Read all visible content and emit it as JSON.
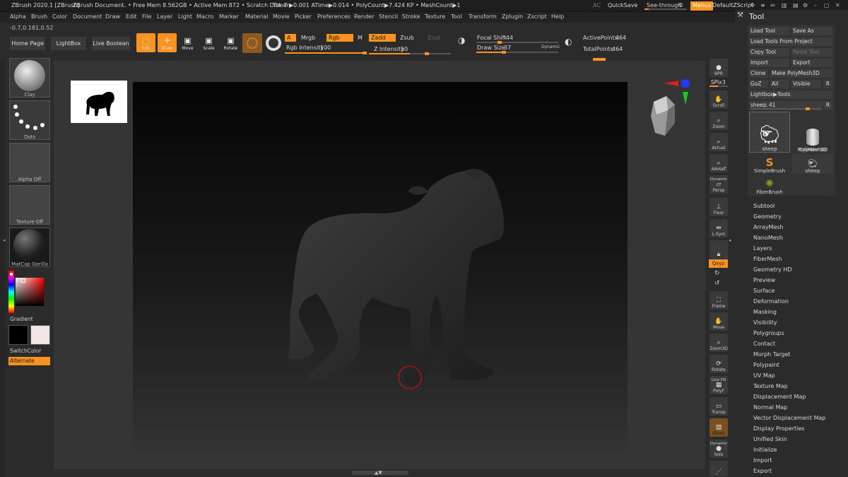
{
  "titlebar": {
    "app": "ZBrush 2020.1 [ZBrush]",
    "document": "ZBrush Document",
    "dots": "..",
    "stats": "• Free Mem 8.562GB • Active Mem 872 • Scratch Disk 7 •",
    "timer": "Timer▶0.001 ATime▶0.014 • PolyCount▶7.424 KP • MeshCount▶1",
    "ac": "AC",
    "quicksave": "QuickSave",
    "seethrough": "See-through",
    "seethrough_value": "0",
    "seethrough_fraction": 0.1,
    "menus": "Menus",
    "zscript": "DefaultZScript"
  },
  "menubar": [
    "Alpha",
    "Brush",
    "Color",
    "Document",
    "Draw",
    "Edit",
    "File",
    "Layer",
    "Light",
    "Macro",
    "Marker",
    "Material",
    "Movie",
    "Picker",
    "Preferences",
    "Render",
    "Stencil",
    "Stroke",
    "Texture",
    "Tool",
    "Transform",
    "Zplugin",
    "Zscript",
    "Help"
  ],
  "coord": "-0.7,0.181,0.52",
  "shelf": {
    "home": "Home Page",
    "lightbox": "LightBox",
    "liveboolean": "Live Boolean",
    "edit": "Edit",
    "draw": "Draw",
    "move": "Move",
    "scale": "Scale",
    "rotate": "Rotate",
    "a": "A",
    "mrgb": "Mrgb",
    "rgb": "Rgb",
    "m": "M",
    "zadd": "Zadd",
    "zsub": "Zsub",
    "zcut": "Zcut",
    "rgb_intensity_label": "Rgb Intensity",
    "rgb_intensity": "100",
    "z_intensity_label": "Z Intensity",
    "z_intensity": "50",
    "focal_shift_label": "Focal Shift",
    "focal_shift": "-44",
    "draw_size_label": "Draw Size",
    "draw_size": "37",
    "dynamic": "Dynamic",
    "active_points_label": "ActivePoints:",
    "active_points": "464",
    "total_points_label": "TotalPoints:",
    "total_points": "464"
  },
  "left": {
    "clay": "Clay",
    "dots": "Dots",
    "alpha": "Alpha Off",
    "texture": "Texture Off",
    "matcap": "MatCap Gorilla",
    "gradient": "Gradient",
    "switchcolor": "SwitchColor",
    "alternate": "Alternate"
  },
  "rightstrip": {
    "bpr": "BPR",
    "spix_label": "SPix",
    "spix": "3",
    "scroll": "Scroll",
    "zoom": "Zoom",
    "actual": "Actual",
    "aahalf": "AAHalf",
    "dynamic": "Dynamic",
    "persp": "Persp",
    "floor": "Floor",
    "lsym": "L.Sym",
    "xyz": "Qxyz",
    "frame": "Frame",
    "move": "Move",
    "zoom3d": "Zoom3D",
    "rotate": "Rotate",
    "linefill": "Line Fill",
    "polyf": "PolyF",
    "transp": "Transp",
    "ghost": "Ghost",
    "solo_dynamic": "Dynamic",
    "solo": "Solo"
  },
  "tool": {
    "title": "Tool",
    "load": "Load Tool",
    "saveas": "Save As",
    "loadfromproject": "Load Tools From Project",
    "copy": "Copy Tool",
    "paste": "Paste Tool",
    "import": "Import",
    "export": "Export",
    "clone": "Clone",
    "makepoly": "Make PolyMesh3D",
    "goz": "GoZ",
    "all": "All",
    "visible": "Visible",
    "r": "R",
    "lightboxtools": "Lightbox▶Tools",
    "current_label": "sheep.",
    "current_value": "41",
    "thumbs": [
      "sheep",
      "Cylinder3D",
      "PolyMesh3D",
      "SimpleBrush",
      "sheep",
      "FiberBrush"
    ]
  },
  "subpalettes": [
    "Subtool",
    "Geometry",
    "ArrayMesh",
    "NanoMesh",
    "Layers",
    "FiberMesh",
    "Geometry HD",
    "Preview",
    "Surface",
    "Deformation",
    "Masking",
    "Visibility",
    "Polygroups",
    "Contact",
    "Morph Target",
    "Polypaint",
    "UV Map",
    "Texture Map",
    "Displacement Map",
    "Normal Map",
    "Vector Displacement Map",
    "Display Properties",
    "Unified Skin",
    "Initialize",
    "Import",
    "Export"
  ],
  "colors": {
    "accent": "#f7931e",
    "panel": "#2b2b2b",
    "button": "#3a3a3a"
  }
}
